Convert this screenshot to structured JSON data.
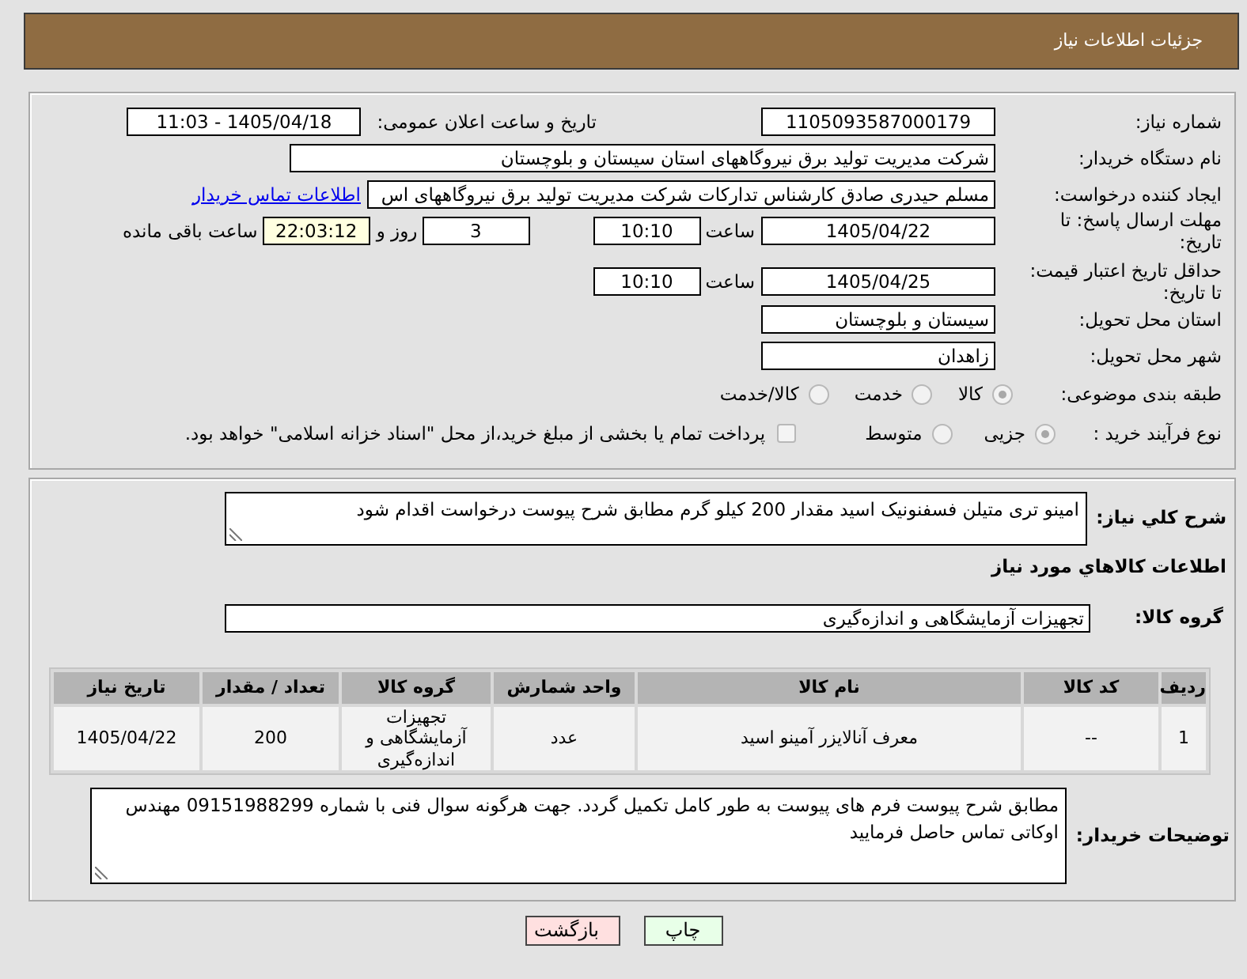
{
  "header": {
    "title": "جزئیات اطلاعات نیاز"
  },
  "details": {
    "need_number": {
      "label": "شماره نیاز:",
      "value": "1105093587000179"
    },
    "announce": {
      "label": "تاریخ و ساعت اعلان عمومی:",
      "value": "1405/04/18 - 11:03"
    },
    "buyer_org": {
      "label": "نام دستگاه خریدار:",
      "value": "شرکت مدیریت تولید برق نیروگاههای استان سیستان و بلوچستان"
    },
    "requester": {
      "label": "ایجاد کننده درخواست:",
      "value": "مسلم حیدری صادق کارشناس تدارکات شرکت مدیریت تولید برق نیروگاههای اس",
      "link": "اطلاعات تماس خریدار"
    },
    "reply_deadline": {
      "label": "مهلت ارسال پاسخ: تا تاریخ:",
      "date": "1405/04/22",
      "time_label": "ساعت",
      "time": "10:10",
      "days": "3",
      "days_label": "روز و",
      "remaining": "22:03:12",
      "remaining_label": "ساعت باقی مانده"
    },
    "price_validity": {
      "label": "حداقل تاریخ اعتبار قیمت: تا تاریخ:",
      "date": "1405/04/25",
      "time_label": "ساعت",
      "time": "10:10"
    },
    "province": {
      "label": "استان محل تحویل:",
      "value": "سیستان و بلوچستان"
    },
    "city": {
      "label": "شهر محل تحویل:",
      "value": "زاهدان"
    },
    "category": {
      "label": "طبقه بندی موضوعی:",
      "options": [
        {
          "label": "کالا",
          "selected": true
        },
        {
          "label": "خدمت",
          "selected": false
        },
        {
          "label": "کالا/خدمت",
          "selected": false
        }
      ]
    },
    "process": {
      "label": "نوع فرآیند خرید :",
      "options": [
        {
          "label": "جزیی",
          "selected": true
        },
        {
          "label": "متوسط",
          "selected": false
        }
      ],
      "treasury": {
        "label": "پرداخت تمام یا بخشی از مبلغ خرید،از محل \"اسناد خزانه اسلامی\" خواهد بود.",
        "checked": false
      }
    }
  },
  "description": {
    "label": "شرح کلي نیاز:",
    "value": "امینو تری متیلن فسفنونیک اسید  مقدار  200 کیلو گرم  مطابق شرح پیوست درخواست اقدام شود"
  },
  "items_title": "اطلاعات کالاهاي مورد نیاز",
  "goods_group": {
    "label": "گروه کالا:",
    "value": "تجهیزات آزمایشگاهی و اندازه‌گیری"
  },
  "table": {
    "columns": [
      "ردیف",
      "کد کالا",
      "نام کالا",
      "واحد شمارش",
      "گروه کالا",
      "تعداد / مقدار",
      "تاریخ نیاز"
    ],
    "rows": [
      [
        "1",
        "--",
        "معرف آنالایزر آمینو اسید",
        "عدد",
        "تجهیزات آزمایشگاهی و اندازه‌گیری",
        "200",
        "1405/04/22"
      ]
    ]
  },
  "buyer_notes": {
    "label": "توضیحات خریدار:",
    "value": "مطابق شرح پیوست  فرم های پیوست به طور کامل تکمیل گردد. جهت هرگونه سوال فنی با شماره 09151988299 مهندس اوکاتی تماس حاصل فرمایید"
  },
  "buttons": [
    {
      "label": "چاپ",
      "kind": "print"
    },
    {
      "label": "بازگشت",
      "kind": "back"
    }
  ]
}
